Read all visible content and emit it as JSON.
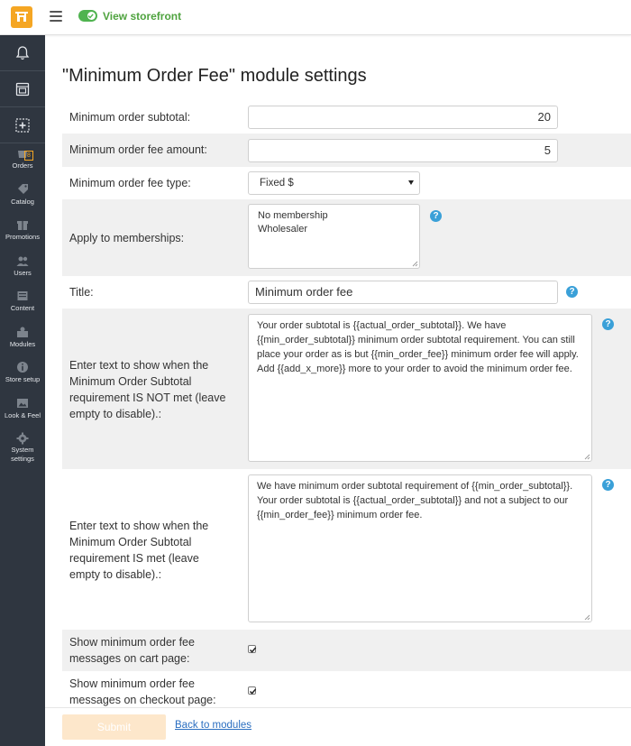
{
  "topbar": {
    "storefront_label": "View storefront"
  },
  "sidebar": {
    "items": [
      {
        "label": "Orders",
        "icon": "orders-icon",
        "badge": "8"
      },
      {
        "label": "Catalog",
        "icon": "catalog-icon"
      },
      {
        "label": "Promotions",
        "icon": "promotions-icon"
      },
      {
        "label": "Users",
        "icon": "users-icon"
      },
      {
        "label": "Content",
        "icon": "content-icon"
      },
      {
        "label": "Modules",
        "icon": "modules-icon"
      },
      {
        "label": "Store setup",
        "icon": "store-setup-icon"
      },
      {
        "label": "Look & Feel",
        "icon": "look-and-feel-icon"
      },
      {
        "label": "System",
        "label2": "settings",
        "icon": "system-settings-icon"
      }
    ]
  },
  "page": {
    "title": "\"Minimum Order Fee\" module settings"
  },
  "form": {
    "min_subtotal_label": "Minimum order subtotal:",
    "min_subtotal_value": "20",
    "fee_amount_label": "Minimum order fee amount:",
    "fee_amount_value": "5",
    "fee_type_label": "Minimum order fee type:",
    "fee_type_value": "Fixed $",
    "memberships_label": "Apply to memberships:",
    "memberships_options": [
      "No membership",
      "Wholesaler"
    ],
    "title_label": "Title:",
    "title_value": "Minimum order fee",
    "not_met_label": "Enter text to show when the Minimum Order Subtotal requirement IS NOT met (leave empty to disable).:",
    "not_met_value": "Your order subtotal is {{actual_order_subtotal}}. We have {{min_order_subtotal}} minimum order subtotal requirement. You can still place your order as is but {{min_order_fee}} minimum order fee will apply. Add {{add_x_more}} more to your order to avoid the minimum order fee.",
    "met_label": "Enter text to show when the Minimum Order Subtotal requirement IS met (leave empty to disable).:",
    "met_value": "We have minimum order subtotal requirement of {{min_order_subtotal}}. Your order subtotal is {{actual_order_subtotal}} and not a subject to our {{min_order_fee}} minimum order fee.",
    "cart_label": "Show minimum order fee messages on cart page:",
    "cart_checked": true,
    "checkout_label": "Show minimum order fee messages on checkout page:",
    "checkout_checked": true
  },
  "footer": {
    "submit_label": "Submit",
    "back_label": "Back to modules"
  },
  "colors": {
    "brand": "#f5a623",
    "sidebar_bg": "#2f3640",
    "help": "#3aa0d8",
    "link": "#2a6ec0",
    "storefront": "#4fa33f"
  }
}
